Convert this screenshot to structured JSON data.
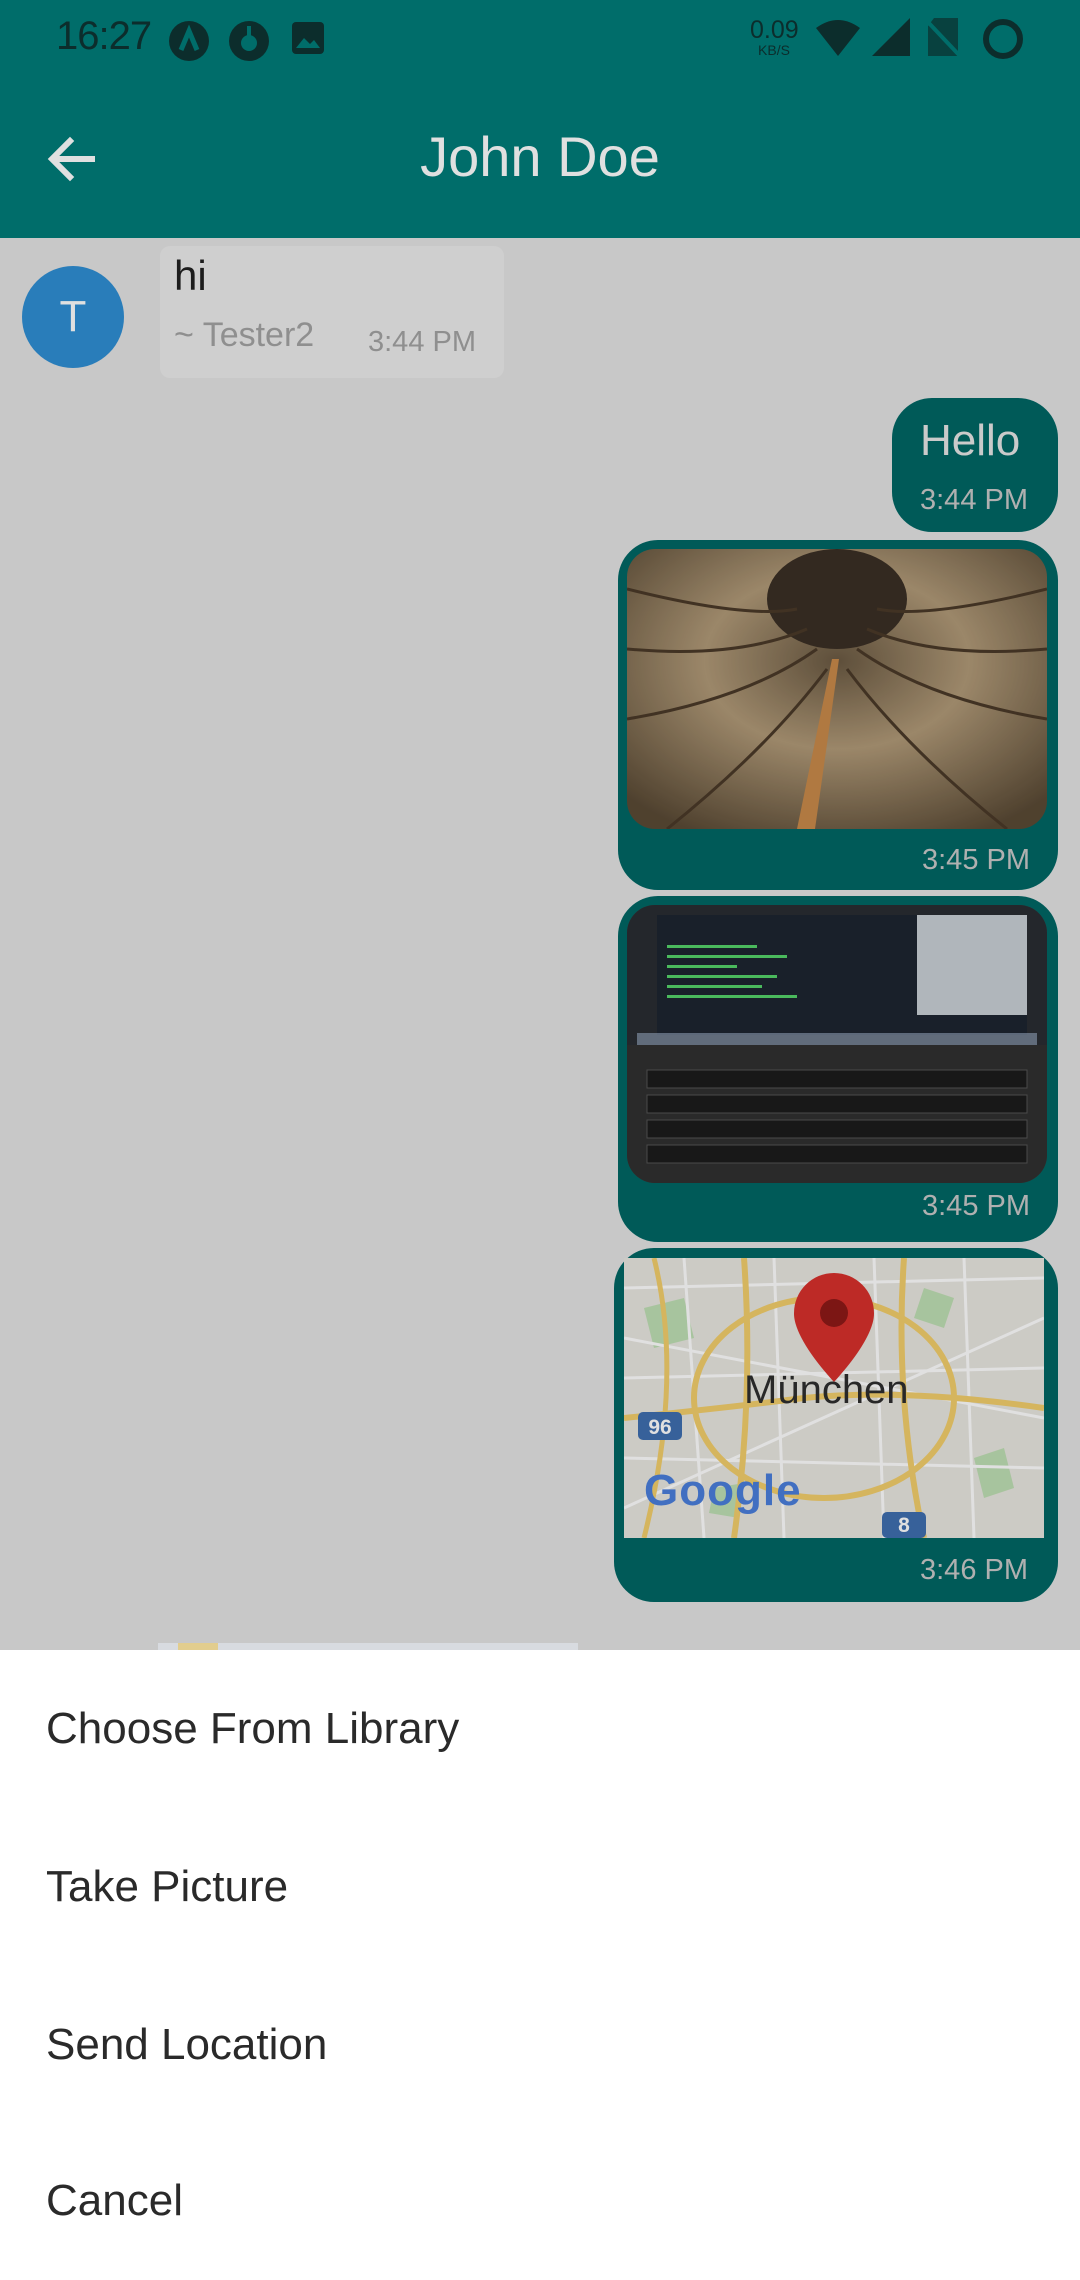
{
  "status_bar": {
    "time": "16:27",
    "net_speed_value": "0.09",
    "net_speed_unit": "KB/S",
    "icons": [
      "app-icon",
      "notification-icon",
      "image-icon",
      "wifi-icon",
      "signal-icon",
      "no-sim-icon",
      "battery-ring-icon"
    ]
  },
  "header": {
    "title": "John Doe",
    "back_icon": "arrow-left-icon",
    "color": "#007d79"
  },
  "messages": {
    "incoming": {
      "avatar_letter": "T",
      "text": "hi",
      "sender": "~ Tester2",
      "time": "3:44 PM"
    },
    "outgoing_text": {
      "text": "Hello",
      "time": "3:44 PM"
    },
    "outgoing_image_1": {
      "time": "3:45 PM"
    },
    "outgoing_image_2": {
      "time": "3:45 PM"
    },
    "outgoing_location": {
      "city": "München",
      "map_brand": "Google",
      "road_96": "96",
      "road_8": "8",
      "time": "3:46 PM"
    },
    "bubble_color": "#006765"
  },
  "sheet": {
    "items": [
      "Choose From Library",
      "Take Picture",
      "Send Location",
      "Cancel"
    ]
  }
}
